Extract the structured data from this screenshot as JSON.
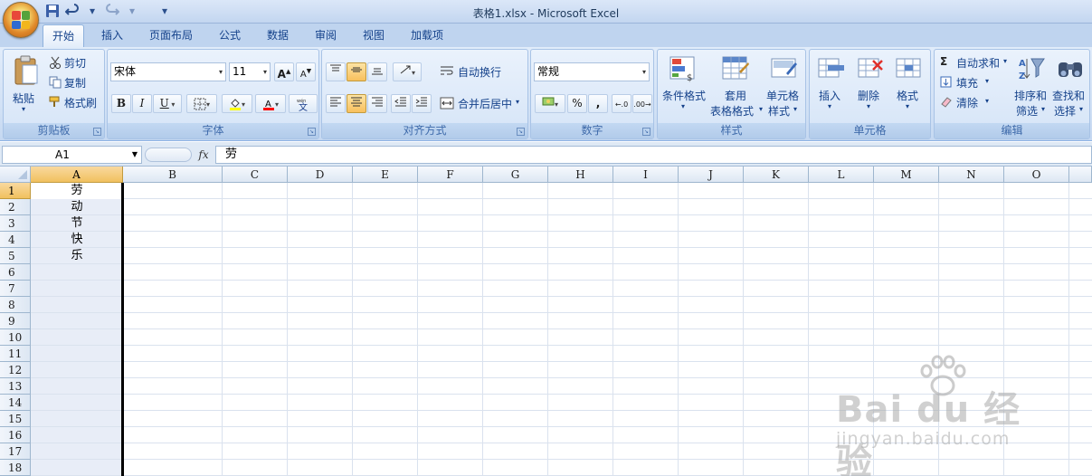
{
  "window": {
    "title": "表格1.xlsx - Microsoft Excel"
  },
  "tabs": [
    {
      "label": "开始",
      "active": true
    },
    {
      "label": "插入"
    },
    {
      "label": "页面布局"
    },
    {
      "label": "公式"
    },
    {
      "label": "数据"
    },
    {
      "label": "审阅"
    },
    {
      "label": "视图"
    },
    {
      "label": "加载项"
    }
  ],
  "ribbon": {
    "clipboard": {
      "label": "剪贴板",
      "paste": "粘贴",
      "cut": "剪切",
      "copy": "复制",
      "format_painter": "格式刷"
    },
    "font": {
      "label": "字体",
      "font_name": "宋体",
      "font_size": "11"
    },
    "alignment": {
      "label": "对齐方式",
      "wrap_text": "自动换行",
      "merge_center": "合并后居中"
    },
    "number": {
      "label": "数字",
      "format": "常规"
    },
    "styles": {
      "label": "样式",
      "conditional": "条件格式",
      "table1": "套用",
      "table2": "表格格式",
      "cell_style1": "单元格",
      "cell_style2": "样式"
    },
    "cells": {
      "label": "单元格",
      "insert": "插入",
      "delete": "删除",
      "format": "格式"
    },
    "editing": {
      "label": "编辑",
      "autosum": "自动求和",
      "fill": "填充",
      "clear": "清除",
      "sort1": "排序和",
      "sort2": "筛选",
      "find1": "查找和",
      "find2": "选择"
    }
  },
  "formula_bar": {
    "name_box": "A1",
    "fx": "fx",
    "content": "劳"
  },
  "grid": {
    "columns": [
      "A",
      "B",
      "C",
      "D",
      "E",
      "F",
      "G",
      "H",
      "I",
      "J",
      "K",
      "L",
      "M",
      "N",
      "O"
    ],
    "rows": [
      "1",
      "2",
      "3",
      "4",
      "5",
      "6",
      "7",
      "8",
      "9",
      "10",
      "11",
      "12",
      "13",
      "14",
      "15",
      "16",
      "17",
      "18"
    ],
    "cells": [
      {
        "ref": "A1",
        "value": "劳"
      },
      {
        "ref": "A2",
        "value": "动"
      },
      {
        "ref": "A3",
        "value": "节"
      },
      {
        "ref": "A4",
        "value": "快"
      },
      {
        "ref": "A5",
        "value": "乐"
      }
    ]
  },
  "watermark": {
    "brand": "Bai du 经验",
    "url": "jingyan.baidu.com"
  },
  "colors": {
    "accent": "#15428b",
    "ribbon": "#d0e0f5",
    "selection": "#f1c15f"
  }
}
